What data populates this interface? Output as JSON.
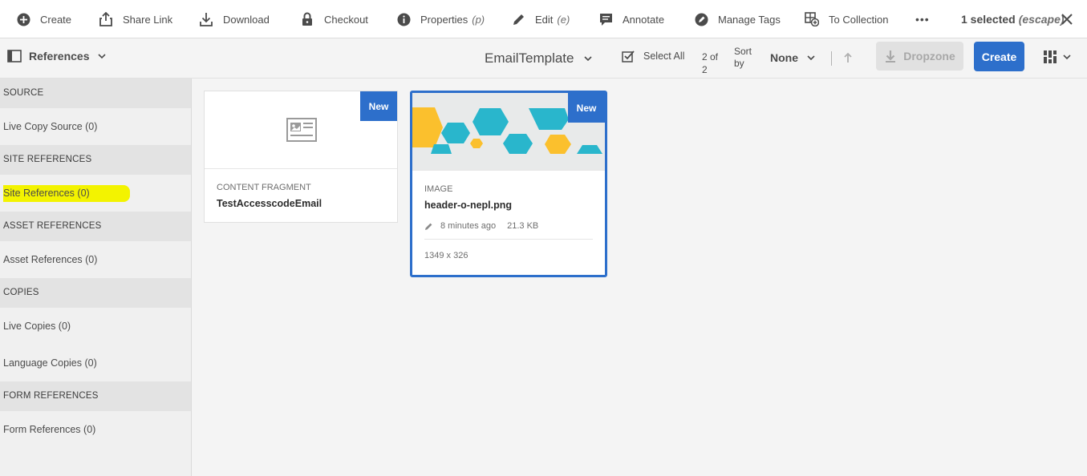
{
  "actions": {
    "create": "Create",
    "share_link": "Share Link",
    "download": "Download",
    "checkout": "Checkout",
    "properties": "Properties",
    "properties_hint": "(p)",
    "edit": "Edit",
    "edit_hint": "(e)",
    "annotate": "Annotate",
    "manage_tags": "Manage Tags",
    "to_collection": "To Collection",
    "more": "•••",
    "selected": "1 selected",
    "selected_hint": "(escape)"
  },
  "toolbar": {
    "rail_label": "References",
    "folder_title": "EmailTemplate",
    "select_all": "Select All",
    "count": "2 of 2",
    "sort_by": "Sort by",
    "sort_value": "None",
    "dropzone": "Dropzone",
    "create": "Create"
  },
  "rail": {
    "sections": [
      {
        "heading": "SOURCE",
        "items": [
          "Live Copy Source (0)"
        ]
      },
      {
        "heading": "SITE REFERENCES",
        "items": [
          "Site References (0)"
        ]
      },
      {
        "heading": "ASSET REFERENCES",
        "items": [
          "Asset References (0)"
        ]
      },
      {
        "heading": "COPIES",
        "items": [
          "Live Copies (0)",
          "Language Copies (0)"
        ]
      },
      {
        "heading": "FORM REFERENCES",
        "items": [
          "Form References (0)"
        ]
      }
    ]
  },
  "cards": [
    {
      "badge": "New",
      "type": "CONTENT FRAGMENT",
      "name": "TestAccesscodeEmail"
    },
    {
      "badge": "New",
      "type": "IMAGE",
      "name": "header-o-nepl.png",
      "modified": "8 minutes ago",
      "size": "21.3 KB",
      "dimensions": "1349 x 326"
    }
  ],
  "colors": {
    "accent": "#2d6fcb",
    "highlight": "#f3f300",
    "hex_teal": "#29b6cc",
    "hex_yellow": "#fbc02d"
  }
}
